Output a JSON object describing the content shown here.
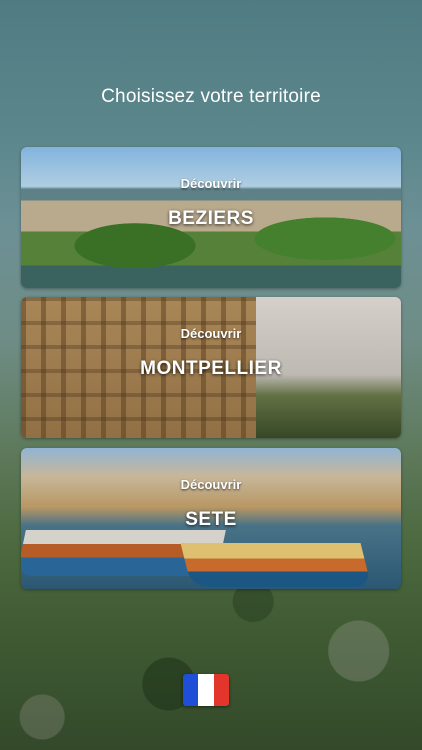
{
  "header": {
    "title": "Choisissez votre territoire"
  },
  "cards": [
    {
      "kicker": "Découvrir",
      "name": "BEZIERS"
    },
    {
      "kicker": "Découvrir",
      "name": "MONTPELLIER"
    },
    {
      "kicker": "Découvrir",
      "name": "SETE"
    }
  ],
  "language": {
    "flag_icon": "france-flag-icon",
    "colors": [
      "#1f4fd6",
      "#ffffff",
      "#e2362d"
    ]
  }
}
